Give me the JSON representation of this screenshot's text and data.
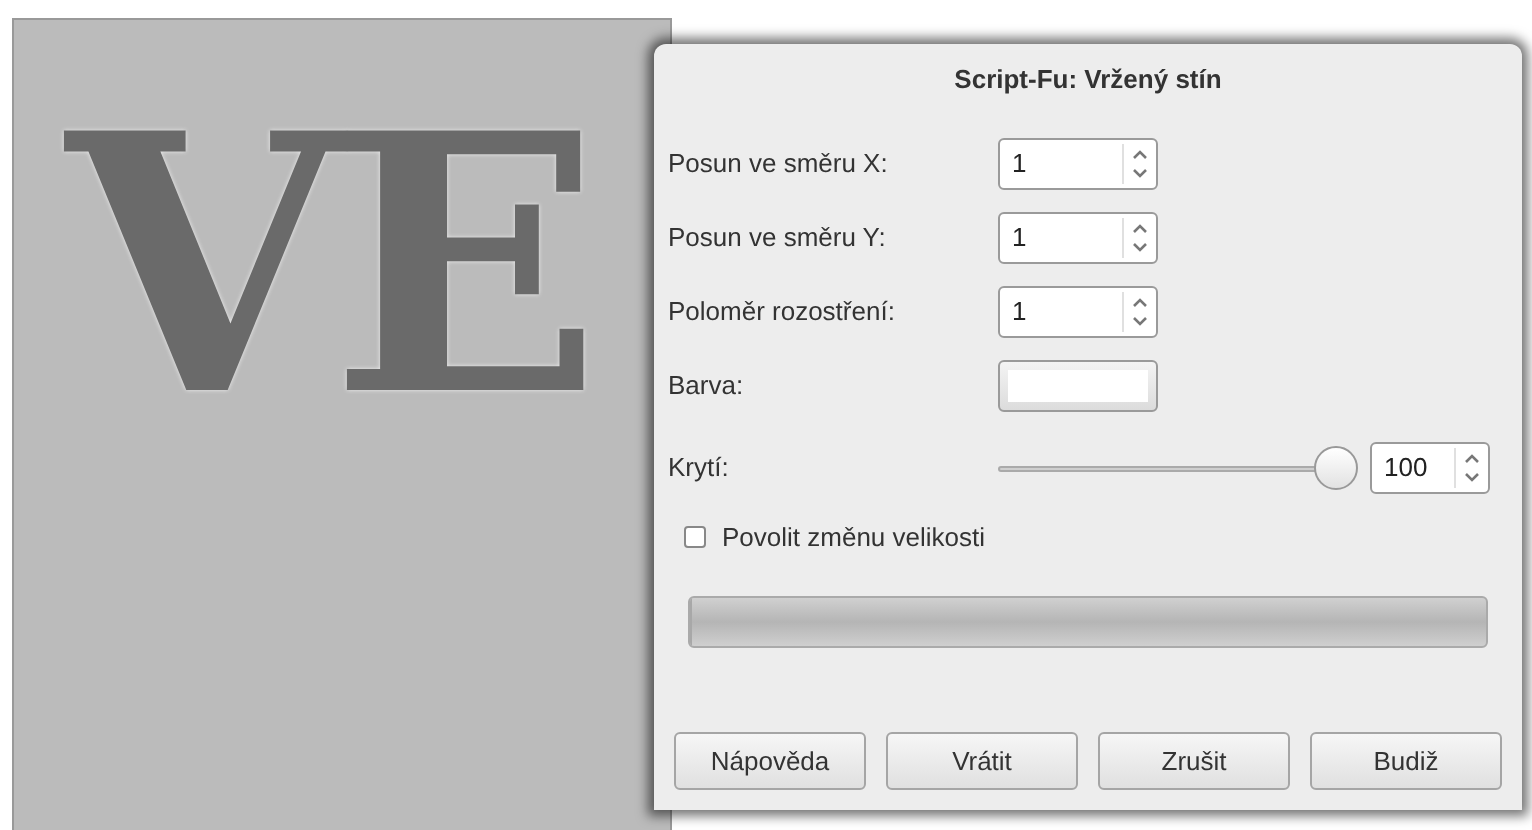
{
  "canvas": {
    "text": "VE"
  },
  "dialog": {
    "title": "Script-Fu: Vržený stín",
    "fields": [
      {
        "kind": "spin",
        "label": "Posun ve směru X:",
        "value": "1"
      },
      {
        "kind": "spin",
        "label": "Posun ve směru Y:",
        "value": "1"
      },
      {
        "kind": "spin",
        "label": "Poloměr rozostření:",
        "value": "1"
      },
      {
        "kind": "color",
        "label": "Barva:",
        "color": "#ffffff"
      },
      {
        "kind": "slider",
        "label": "Krytí:",
        "level": 1,
        "value": "100"
      }
    ],
    "checkbox": {
      "label": "Povolit změnu velikosti",
      "checked": false
    },
    "progress": {
      "level": 0
    },
    "buttons": [
      "Nápověda",
      "Vrátit",
      "Zrušit",
      "Budiž"
    ]
  }
}
